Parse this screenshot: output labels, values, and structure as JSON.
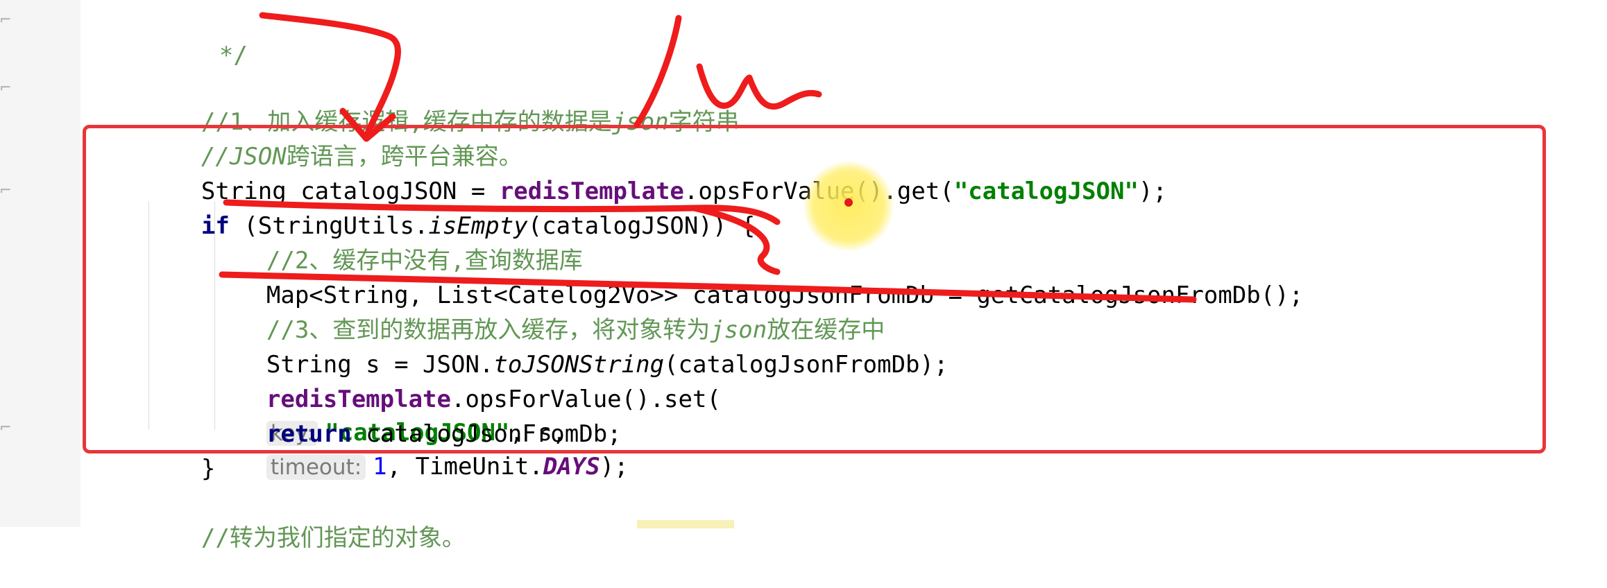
{
  "code": {
    "comment_close": "*/",
    "comment1_prefix": "//1、加入缓存逻辑,缓存中存的数据是",
    "comment1_json": "json",
    "comment1_suffix": "字符串",
    "comment2_json": "//JSON",
    "comment2_suffix": "跨语言，跨平台兼容。",
    "line3": {
      "type": "String ",
      "var": "catalogJSON",
      "eq": " = ",
      "field": "redisTemplate",
      "call": ".opsForValue().get(",
      "arg": "\"catalogJSON\"",
      "end": ");"
    },
    "line4": {
      "kw": "if",
      "open": " (StringUtils.",
      "method": "isEmpty",
      "args": "(catalogJSON)) {"
    },
    "comment3": "//2、缓存中没有,查询数据库",
    "line6": "Map<String, List<Catelog2Vo>> catalogJsonFromDb = getCatalogJsonFromDb();",
    "comment4_prefix": "//3、查到的数据再放入缓存，将对象转为",
    "comment4_json": "json",
    "comment4_suffix": "放在缓存中",
    "line8": {
      "start": "String s = JSON.",
      "method": "toJSONString",
      "args": "(catalogJsonFromDb);"
    },
    "line9": {
      "field": "redisTemplate",
      "call": ".opsForValue().set(",
      "hint_key": "key:",
      "arg_key": "\"catalogJSON\"",
      "mid": ", s,",
      "hint_timeout": "timeout:",
      "num": "1",
      "unit_prefix": ", TimeUnit.",
      "unit": "DAYS",
      "end": ");"
    },
    "line10": {
      "kw": "return",
      "rest": " catalogJsonFromDb;"
    },
    "close_brace": "}",
    "comment5": "//转为我们指定的对象。"
  },
  "colors": {
    "comment": "#629755",
    "keyword": "#000080",
    "field": "#660e7a",
    "string": "#008000",
    "number": "#0000ff",
    "annotation_red": "#e8363a",
    "cursor_highlight": "#ffec5a"
  },
  "icons": [
    "fold-marker-icon"
  ]
}
